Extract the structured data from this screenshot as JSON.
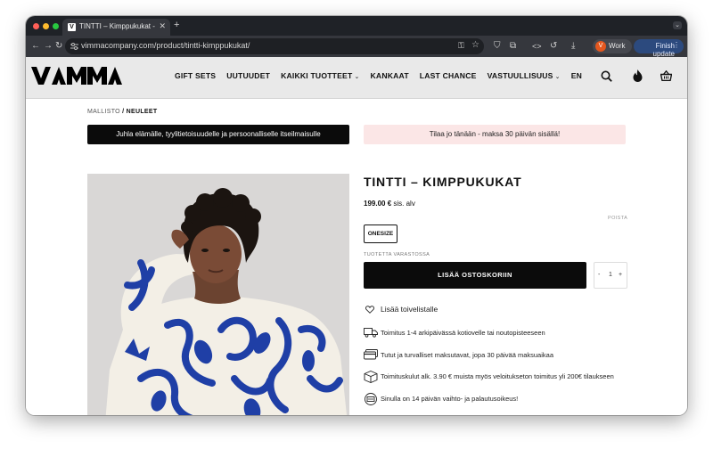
{
  "browser": {
    "tab_title": "TINTTI – Kimppukukat - Vimma",
    "tab_favicon": "V",
    "new_tab_icon": "plus-icon",
    "url": "vimmacompany.com/product/tintti-kimppukukat/",
    "profile_initial": "V",
    "profile_label": "Work",
    "finish_label": "Finish update",
    "traffic_light_colors": [
      "#ff5f57",
      "#febc2e",
      "#28c840"
    ]
  },
  "site": {
    "nav": [
      {
        "label": "GIFT SETS",
        "dropdown": false
      },
      {
        "label": "UUTUUDET",
        "dropdown": false
      },
      {
        "label": "KAIKKI TUOTTEET",
        "dropdown": true
      },
      {
        "label": "KANKAAT",
        "dropdown": false
      },
      {
        "label": "LAST CHANCE",
        "dropdown": false
      },
      {
        "label": "VASTUULLISUUS",
        "dropdown": true
      },
      {
        "label": "EN",
        "dropdown": false
      }
    ],
    "header_icons": [
      "search-icon",
      "flame-icon",
      "basket-icon"
    ]
  },
  "breadcrumb": {
    "parent": "MALLISTO",
    "separator": " / ",
    "current": "NEULEET"
  },
  "promos": {
    "dark": "Juhla elämälle, tyylitietoisuudelle ja persoonalliselle itseilmaisulle",
    "pink": "Tilaa jo tänään - maksa 30 päivän sisällä!"
  },
  "product": {
    "title": "TINTTI – KIMPPUKUKAT",
    "price": "199.00 €",
    "price_suffix": " sis. alv",
    "reset_label": "POISTA",
    "size": "ONESIZE",
    "stock_label": "TUOTETTA VARASTOSSA",
    "add_to_cart": "LISÄÄ OSTOSKORIIN",
    "quantity": "1",
    "qty_minus": "-",
    "qty_plus": "+",
    "wishlist": "Lisää toivelistalle"
  },
  "features": [
    {
      "icon": "truck-icon",
      "text": "Toimitus 1-4 arkipäivässä kotiovelle tai noutopisteeseen"
    },
    {
      "icon": "credit-card-icon",
      "text": "Tutut ja turvalliset maksutavat, jopa 30 päivää maksuaikaa"
    },
    {
      "icon": "package-icon",
      "text": "Toimituskulut alk. 3.90 € muista myös veloitukseton toimitus yli 200€ tilaukseen"
    },
    {
      "icon": "return-icon",
      "text": "Sinulla on 14 päivän vaihto- ja palautusoikeus!"
    }
  ],
  "colors": {
    "accent_blue": "#1f3fa6",
    "promo_pink": "#fbe6e6",
    "cart_black": "#0b0b0b"
  }
}
